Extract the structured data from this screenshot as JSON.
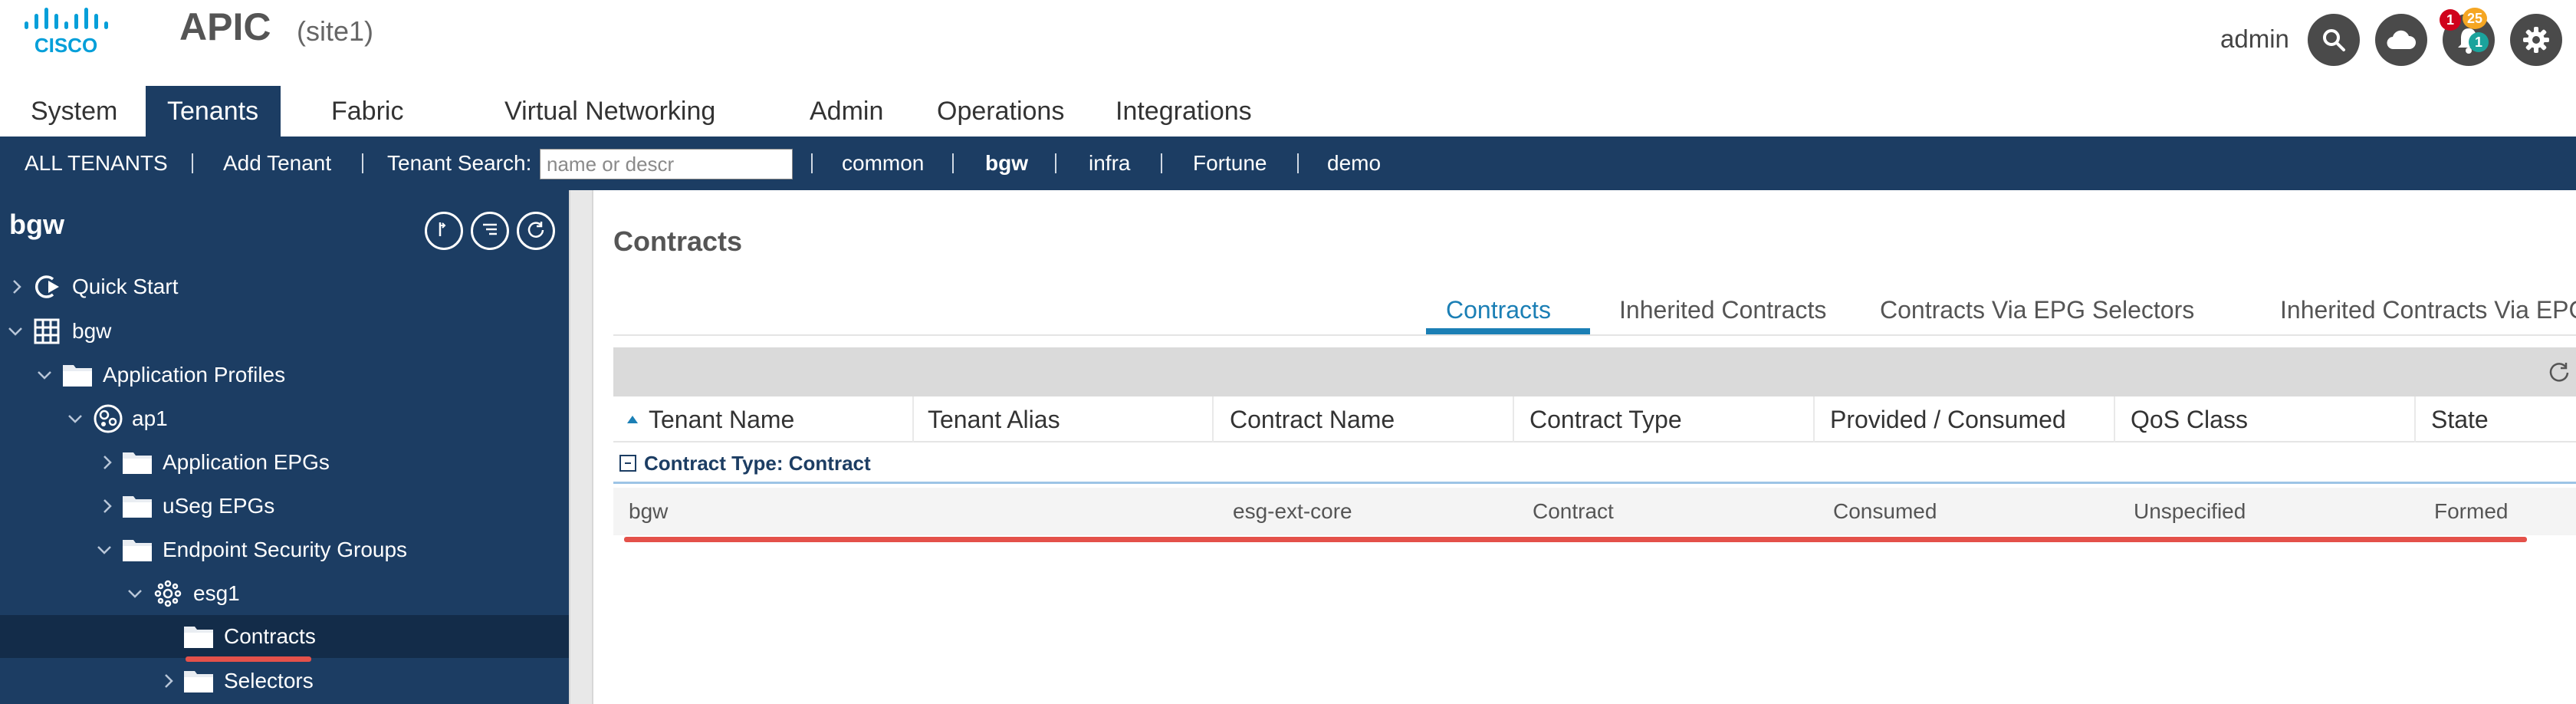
{
  "header": {
    "app_title": "APIC",
    "site": "(site1)",
    "user": "admin",
    "notification_badge_red": "1",
    "notification_badge_orange": "25",
    "notification_badge_teal": "1",
    "icons": [
      "cisco-logo",
      "search-icon",
      "cloud-icon",
      "bell-icon",
      "gear-icon"
    ]
  },
  "main_nav": {
    "tabs": [
      "System",
      "Tenants",
      "Fabric",
      "Virtual Networking",
      "Admin",
      "Operations",
      "Integrations"
    ],
    "active": "Tenants"
  },
  "sub_nav": {
    "all_tenants": "ALL TENANTS",
    "add_tenant": "Add Tenant",
    "search_label": "Tenant Search:",
    "search_placeholder": "name or descr",
    "tenants": [
      "common",
      "bgw",
      "infra",
      "Fortune",
      "demo"
    ],
    "active_tenant": "bgw"
  },
  "sidebar": {
    "title": "bgw",
    "tree": [
      {
        "label": "Quick Start",
        "icon": "quick-start-icon"
      },
      {
        "label": "bgw",
        "icon": "tenant-grid-icon"
      },
      {
        "label": "Application Profiles",
        "icon": "folder-icon"
      },
      {
        "label": "ap1",
        "icon": "app-profile-icon"
      },
      {
        "label": "Application EPGs",
        "icon": "folder-icon"
      },
      {
        "label": "uSeg EPGs",
        "icon": "folder-icon"
      },
      {
        "label": "Endpoint Security Groups",
        "icon": "folder-icon"
      },
      {
        "label": "esg1",
        "icon": "esg-icon"
      },
      {
        "label": "Contracts",
        "icon": "folder-icon"
      },
      {
        "label": "Selectors",
        "icon": "folder-icon"
      }
    ],
    "selected": "Contracts"
  },
  "content": {
    "title": "Contracts",
    "tabs": [
      "Contracts",
      "Inherited Contracts",
      "Contracts Via EPG Selectors",
      "Inherited Contracts Via EPG"
    ],
    "active_tab": "Contracts",
    "columns": [
      "Tenant Name",
      "Tenant Alias",
      "Contract Name",
      "Contract Type",
      "Provided / Consumed",
      "QoS Class",
      "State"
    ],
    "sort_column": "Tenant Name",
    "sort_direction": "ascending",
    "group_label": "Contract Type: Contract",
    "rows": [
      {
        "tenant_name": "bgw",
        "tenant_alias": "",
        "contract_name": "esg-ext-core",
        "contract_type": "Contract",
        "provided_consumed": "Consumed",
        "qos_class": "Unspecified",
        "state": "Formed"
      }
    ]
  },
  "colors": {
    "nav_blue": "#1c3d63",
    "accent_blue": "#1b7fb5",
    "highlight_red": "#e4514a",
    "badge_red": "#d0021b",
    "badge_orange": "#f5a623",
    "badge_teal": "#1ba39c"
  }
}
